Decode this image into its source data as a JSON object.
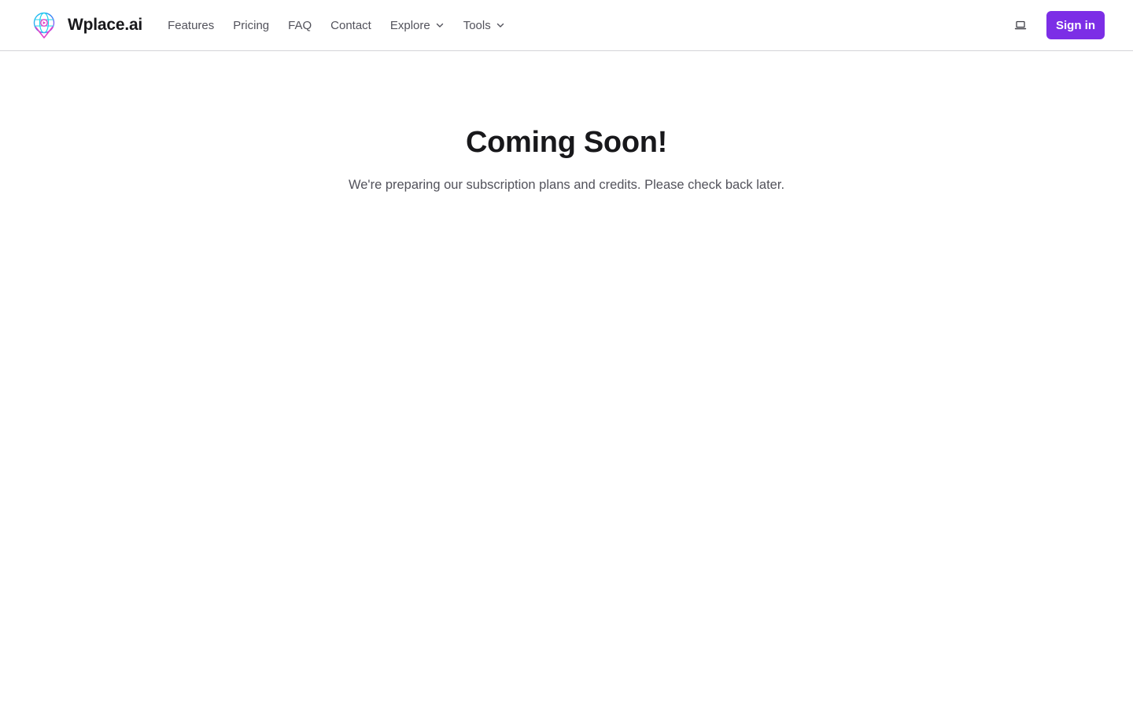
{
  "header": {
    "brand_name": "Wplace.ai",
    "nav": [
      {
        "label": "Features",
        "icon": null
      },
      {
        "label": "Pricing",
        "icon": null
      },
      {
        "label": "FAQ",
        "icon": null
      },
      {
        "label": "Contact",
        "icon": null
      },
      {
        "label": "Explore",
        "icon": "chevron-down-icon"
      },
      {
        "label": "Tools",
        "icon": "chevron-down-icon"
      }
    ],
    "theme_icon": "laptop-icon",
    "signin_label": "Sign in"
  },
  "main": {
    "title": "Coming Soon!",
    "subtitle": "We're preparing our subscription plans and credits. Please check back later."
  },
  "colors": {
    "accent": "#7c2ee6",
    "text_primary": "#18181b",
    "text_muted": "#52525b",
    "border": "#d4d4d8",
    "background": "#ffffff"
  }
}
